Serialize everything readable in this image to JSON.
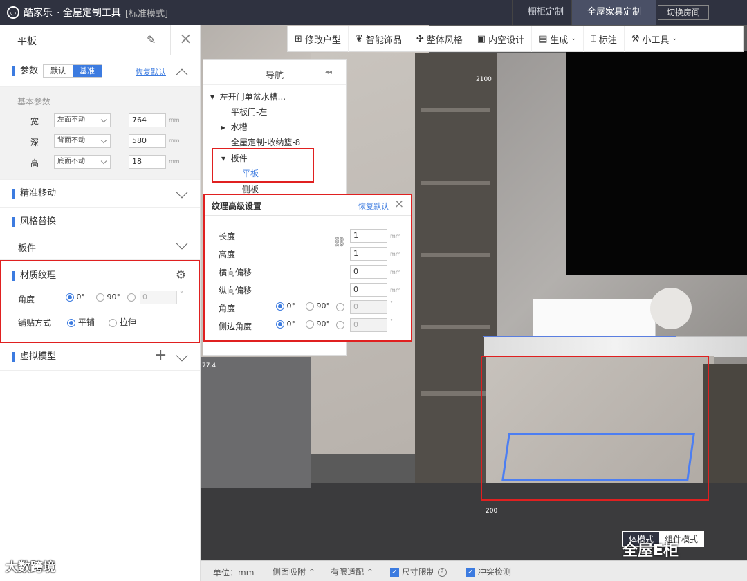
{
  "app": {
    "brand": "酷家乐",
    "title": "· 全屋定制工具",
    "mode": "[标准模式]"
  },
  "topbar": {
    "tabs": [
      {
        "label": "橱柜定制"
      },
      {
        "label": "全屋家具定制"
      }
    ],
    "switch_room": "切换房间"
  },
  "toolbar": {
    "items": [
      {
        "label": "修改户型"
      },
      {
        "label": "智能饰品"
      },
      {
        "label": "整体风格"
      },
      {
        "label": "内空设计"
      },
      {
        "label": "生成"
      },
      {
        "label": "标注"
      },
      {
        "label": "小工具"
      }
    ]
  },
  "panel": {
    "title": "平板",
    "params": {
      "label": "参数",
      "toggle": [
        "默认",
        "基准"
      ],
      "restore": "恢复默认",
      "basic": "基本参数",
      "rows": [
        {
          "label": "宽",
          "mode": "左面不动",
          "value": "764",
          "unit": "mm"
        },
        {
          "label": "深",
          "mode": "背面不动",
          "value": "580",
          "unit": "mm"
        },
        {
          "label": "高",
          "mode": "底面不动",
          "value": "18",
          "unit": "mm"
        }
      ]
    },
    "precise": "精准移动",
    "style": {
      "label": "风格替换",
      "sub": "板件"
    },
    "material": {
      "label": "材质纹理",
      "angle_label": "角度",
      "angles": [
        "0°",
        "90°"
      ],
      "angle_value": "0",
      "angle_unit": "°",
      "paste_label": "铺贴方式",
      "paste": [
        "平铺",
        "拉伸"
      ]
    },
    "virtual": "虚拟模型"
  },
  "nav": {
    "title": "导航",
    "items": [
      {
        "label": "左开门单盆水槽..."
      },
      {
        "label": "平板门-左"
      },
      {
        "label": "水槽"
      },
      {
        "label": "全屋定制-收纳篮-8"
      },
      {
        "label": "板件"
      },
      {
        "label": "平板"
      },
      {
        "label": "侧板"
      }
    ]
  },
  "texture": {
    "title": "纹理高级设置",
    "restore": "恢复默认",
    "rows": [
      {
        "label": "长度",
        "value": "1",
        "unit": "mm"
      },
      {
        "label": "高度",
        "value": "1",
        "unit": "mm"
      },
      {
        "label": "横向偏移",
        "value": "0",
        "unit": "mm"
      },
      {
        "label": "纵向偏移",
        "value": "0",
        "unit": "mm"
      }
    ],
    "angle": {
      "label": "角度",
      "opts": [
        "0°",
        "90°"
      ],
      "value": "0",
      "unit": "°"
    },
    "side_angle": {
      "label": "侧边角度",
      "opts": [
        "0°",
        "90°"
      ],
      "value": "0",
      "unit": "°"
    }
  },
  "scene": {
    "dim_top": "2100",
    "dim_bottom": "200",
    "dim_left": "77.4",
    "mode_buttons": [
      "体模式",
      "组件模式"
    ]
  },
  "watermarks": {
    "left": "大数跨境",
    "right": "全屋E柜"
  },
  "bottom": {
    "unit": "单位：mm",
    "side": "侧面吸附",
    "limited": "有限适配",
    "size_limit": "尺寸限制",
    "conflict": "冲突检测"
  }
}
